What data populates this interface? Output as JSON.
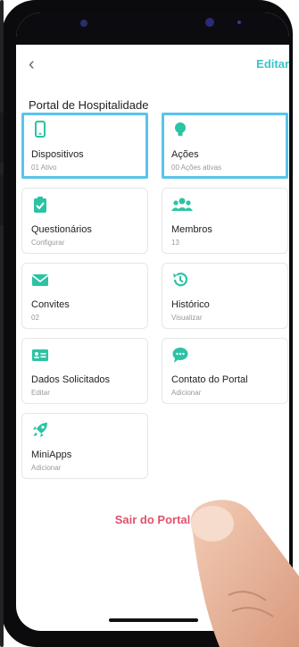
{
  "header": {
    "back_label": "‹",
    "edit_label": "Editar"
  },
  "page_title": "Portal de Hospitalidade",
  "cards": [
    {
      "label": "Dispositivos",
      "sub": "01 Ativo",
      "icon": "phone-icon"
    },
    {
      "label": "Ações",
      "sub": "00 Ações ativas",
      "icon": "lightbulb-icon"
    },
    {
      "label": "Questionários",
      "sub": "Configurar",
      "icon": "clipboard-check-icon"
    },
    {
      "label": "Membros",
      "sub": "13",
      "icon": "users-icon"
    },
    {
      "label": "Convites",
      "sub": "02",
      "icon": "envelope-icon"
    },
    {
      "label": "Histórico",
      "sub": "Visualizar",
      "icon": "history-icon"
    },
    {
      "label": "Dados Solicitados",
      "sub": "Editar",
      "icon": "id-card-icon"
    },
    {
      "label": "Contato do Portal",
      "sub": "Adicionar",
      "icon": "chat-icon"
    },
    {
      "label": "MiniApps",
      "sub": "Adicionar",
      "icon": "rocket-icon"
    }
  ],
  "logout_label": "Sair do Portal",
  "colors": {
    "accent": "#3cc4c9",
    "icon_green": "#2cc3a4",
    "highlight": "#5bc3ec",
    "logout": "#e0526a"
  }
}
